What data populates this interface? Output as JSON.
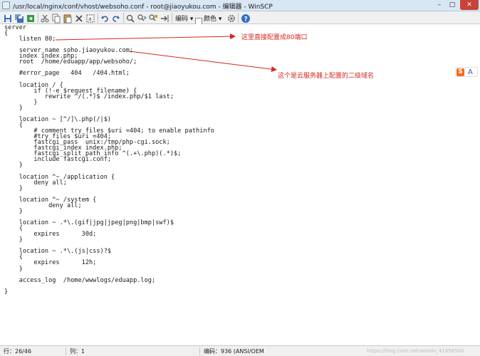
{
  "window": {
    "title": "/usr/local/nginx/conf/vhost/websoho.conf - root@jiaoyukou.com - 编辑器 - WinSCP",
    "controls": {
      "minimize": "–",
      "maximize": "□",
      "close": "✕"
    }
  },
  "toolbar": {
    "icons": [
      "save-icon",
      "save-all-icon",
      "refresh-icon",
      "cut-icon",
      "copy-icon",
      "paste-icon",
      "delete-icon",
      "select-all-icon",
      "undo-icon",
      "redo-icon",
      "find-icon",
      "find-next-icon",
      "replace-icon",
      "goto-line-icon",
      "encoding-icon"
    ],
    "encoding_label": "编码 ▾",
    "color_label": "颜色 ▾",
    "help_icon": "help-icon"
  },
  "code": [
    "server",
    "{",
    "    listen 80;",
    "",
    "    server_name soho.jiaoyukou.com;",
    "    index index.php;",
    "    root  /home/eduapp/app/websoho/;",
    "",
    "    #error_page   404   /404.html;",
    "",
    "    location / {",
    "        if (!-e $request_filename) {",
    "           rewrite ^/(.*)$ /index.php/$1 last;",
    "        }",
    "    }",
    "",
    "    location ~ [^/]\\.php(/|$)",
    "    {",
    "        # comment try_files $uri =404; to enable pathinfo",
    "        #try_files $uri =404;",
    "        fastcgi_pass  unix:/tmp/php-cgi.sock;",
    "        fastcgi_index index.php;",
    "        fastcgi_split_path_info ^(.+\\.php)(.*)$;",
    "        include fastcgi.conf;",
    "    }",
    "",
    "    location ^~ /application {",
    "        deny all;",
    "    }",
    "",
    "    location ^~ /system {",
    "            deny all;",
    "    }",
    "",
    "    location ~ .*\\.(gif|jpg|jpeg|png|bmp|swf)$",
    "    {",
    "        expires      30d;",
    "    }",
    "",
    "    location ~ .*\\.(js|css)?$",
    "    {",
    "        expires      12h;",
    "    }",
    "",
    "    access_log  /home/wwwlogs/eduapp.log;",
    "",
    "}"
  ],
  "annotations": {
    "port_note": "这里直接配置成80端口",
    "domain_note": "这个是云服务器上配置的二级域名",
    "color": "#d6271c"
  },
  "ime": {
    "s": "S",
    "a": "A"
  },
  "status": {
    "line": "行：26/46",
    "column": "列：1",
    "encoding": "编码：936  (ANSI/OEM",
    "watermark": "https://blog.csdn.net/weixin_41858560"
  }
}
